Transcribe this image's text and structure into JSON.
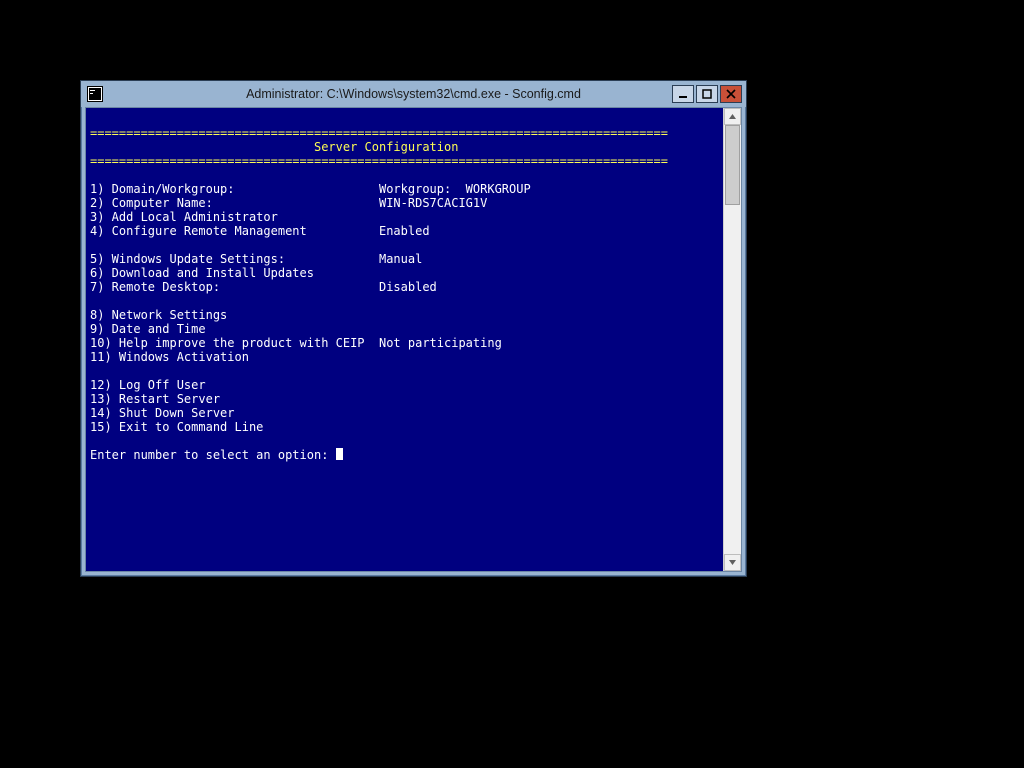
{
  "window": {
    "title": "Administrator: C:\\Windows\\system32\\cmd.exe - Sconfig.cmd"
  },
  "console": {
    "divider": "================================================================================",
    "header_title": "                               Server Configuration",
    "blank": "",
    "menu": {
      "m1_label": "1) Domain/Workgroup:",
      "m1_value": "Workgroup:  WORKGROUP",
      "m2_label": "2) Computer Name:",
      "m2_value": "WIN-RDS7CACIG1V",
      "m3_label": "3) Add Local Administrator",
      "m3_value": "",
      "m4_label": "4) Configure Remote Management",
      "m4_value": "Enabled",
      "m5_label": "5) Windows Update Settings:",
      "m5_value": "Manual",
      "m6_label": "6) Download and Install Updates",
      "m6_value": "",
      "m7_label": "7) Remote Desktop:",
      "m7_value": "Disabled",
      "m8_label": "8) Network Settings",
      "m8_value": "",
      "m9_label": "9) Date and Time",
      "m9_value": "",
      "m10_label": "10) Help improve the product with CEIP",
      "m10_value": "Not participating",
      "m11_label": "11) Windows Activation",
      "m11_value": "",
      "m12_label": "12) Log Off User",
      "m12_value": "",
      "m13_label": "13) Restart Server",
      "m13_value": "",
      "m14_label": "14) Shut Down Server",
      "m14_value": "",
      "m15_label": "15) Exit to Command Line",
      "m15_value": ""
    },
    "prompt": "Enter number to select an option: "
  }
}
